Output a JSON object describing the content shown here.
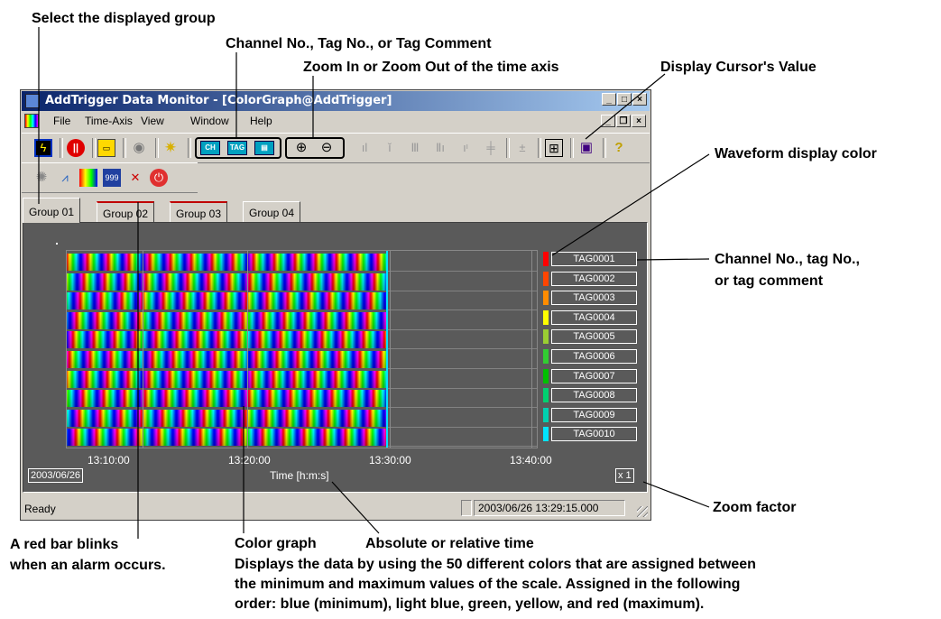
{
  "annotations": {
    "select_group": "Select the displayed group",
    "channel_tag": "Channel No., Tag No., or Tag Comment",
    "zoom_time": "Zoom In or Zoom Out of the time axis",
    "cursor_value": "Display Cursor's Value",
    "waveform_color": "Waveform display color",
    "channel_tag_right_1": "Channel No., tag No.,",
    "channel_tag_right_2": "or tag comment",
    "zoom_factor": "Zoom factor",
    "red_bar_1": "A red bar blinks",
    "red_bar_2": "when an alarm occurs.",
    "color_graph": "Color graph",
    "abs_rel_time": "Absolute or relative time",
    "desc_1": "Displays the data by using the 50 different colors that are assigned between",
    "desc_2": "the minimum and maximum values of the scale.  Assigned in the following",
    "desc_3": "order: blue (minimum), light blue, green, yellow, and red (maximum)."
  },
  "window": {
    "title": "AddTrigger Data Monitor - [ColorGraph@AddTrigger]",
    "menu": [
      "File",
      "Time-Axis",
      "View",
      "Window",
      "Help"
    ],
    "tabs": [
      {
        "label": "Group 01",
        "active": true,
        "alarm": false
      },
      {
        "label": "Group 02",
        "active": false,
        "alarm": true
      },
      {
        "label": "Group 03",
        "active": false,
        "alarm": true
      },
      {
        "label": "Group 04",
        "active": false,
        "alarm": false
      }
    ],
    "toolbar": {
      "ch_label": "CH",
      "tag_label": "TAG"
    },
    "tags": [
      {
        "name": "TAG0001",
        "color": "#ff0000"
      },
      {
        "name": "TAG0002",
        "color": "#ff4500"
      },
      {
        "name": "TAG0003",
        "color": "#ff8c00"
      },
      {
        "name": "TAG0004",
        "color": "#ffff00"
      },
      {
        "name": "TAG0005",
        "color": "#9acd32"
      },
      {
        "name": "TAG0006",
        "color": "#32cd32"
      },
      {
        "name": "TAG0007",
        "color": "#00c000"
      },
      {
        "name": "TAG0008",
        "color": "#00d070"
      },
      {
        "name": "TAG0009",
        "color": "#00d0b0"
      },
      {
        "name": "TAG0010",
        "color": "#00e5ff"
      }
    ],
    "time_ticks": [
      "13:10:00",
      "13:20:00",
      "13:30:00",
      "13:40:00"
    ],
    "date": "2003/06/26",
    "axis_label": "Time [h:m:s]",
    "zoom": "x 1",
    "status": "Ready",
    "status_time": "2003/06/26 13:29:15.000"
  }
}
